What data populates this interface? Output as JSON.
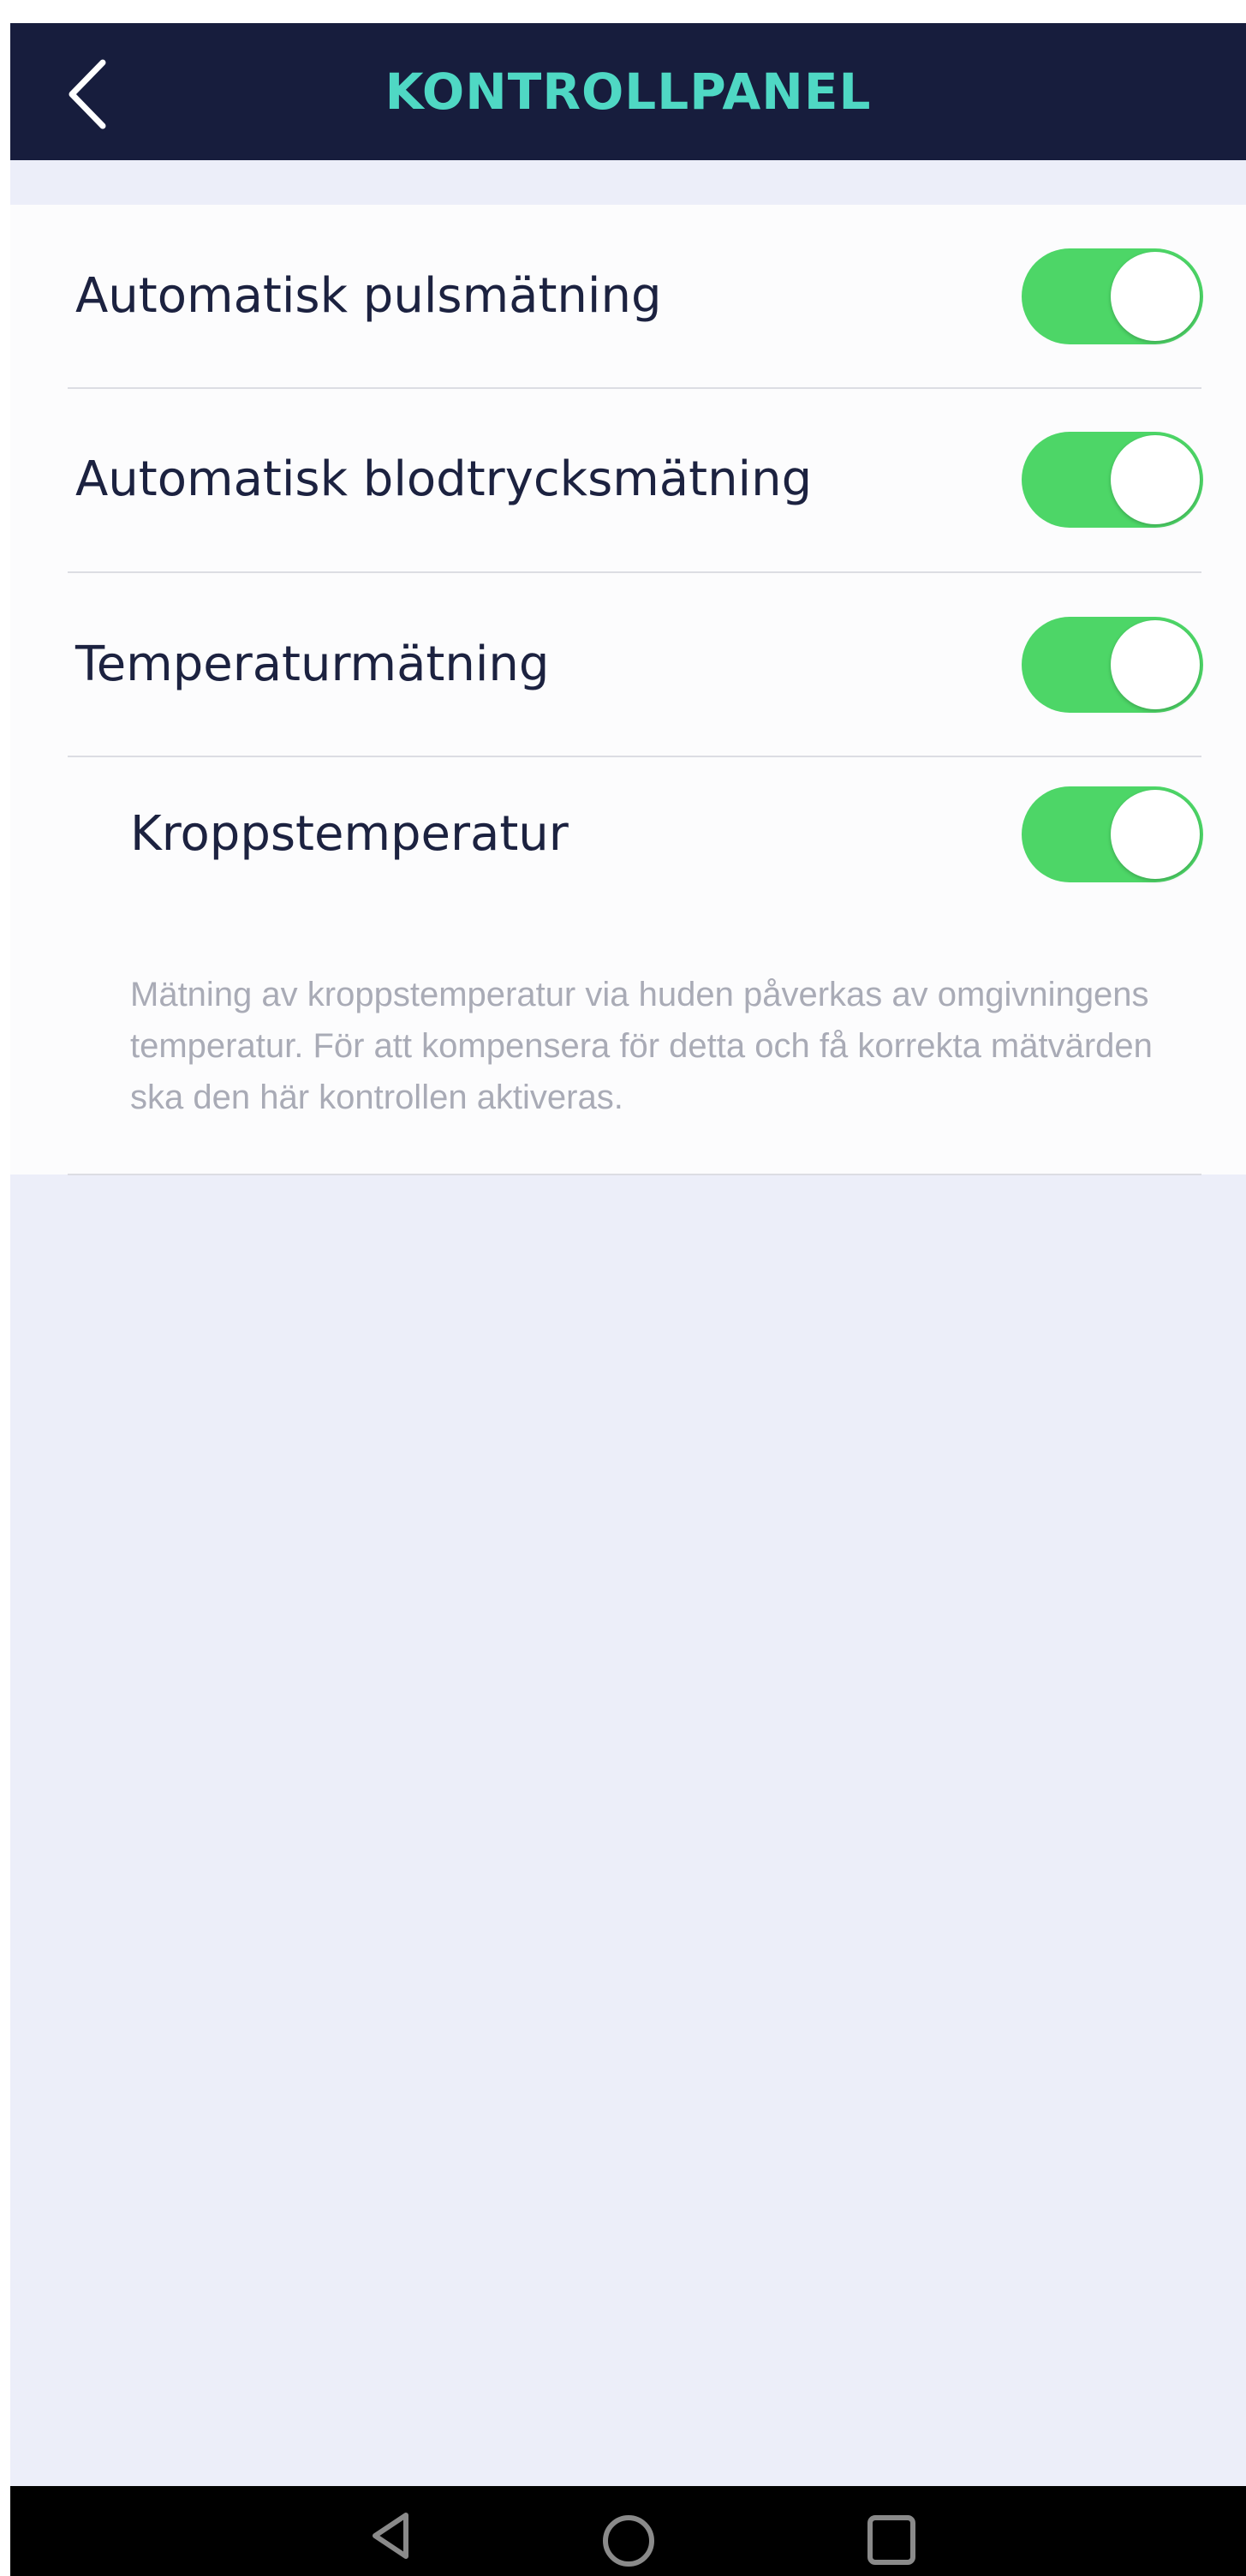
{
  "header": {
    "title": "KONTROLLPANEL",
    "back_icon": "chevron-left-icon",
    "background_color": "#171d3d",
    "title_color": "#4fd8c4"
  },
  "settings": [
    {
      "label": "Automatisk pulsmätning",
      "enabled": true
    },
    {
      "label": "Automatisk blodtrycksmätning",
      "enabled": true
    },
    {
      "label": "Temperaturmätning",
      "enabled": true
    },
    {
      "label": "Kroppstemperatur",
      "enabled": true
    }
  ],
  "description": "Mätning av kroppstemperatur via huden påverkas av omgivningens temperatur. För att kompensera för detta och få korrekta mätvärden ska den här kontrollen aktiveras.",
  "navbar": {
    "back_icon": "triangle-back-icon",
    "home_icon": "circle-home-icon",
    "recents_icon": "square-recents-icon"
  },
  "colors": {
    "toggle_on": "#4dd667",
    "page_background": "#eceef9",
    "panel_background": "#fcfcfd"
  }
}
